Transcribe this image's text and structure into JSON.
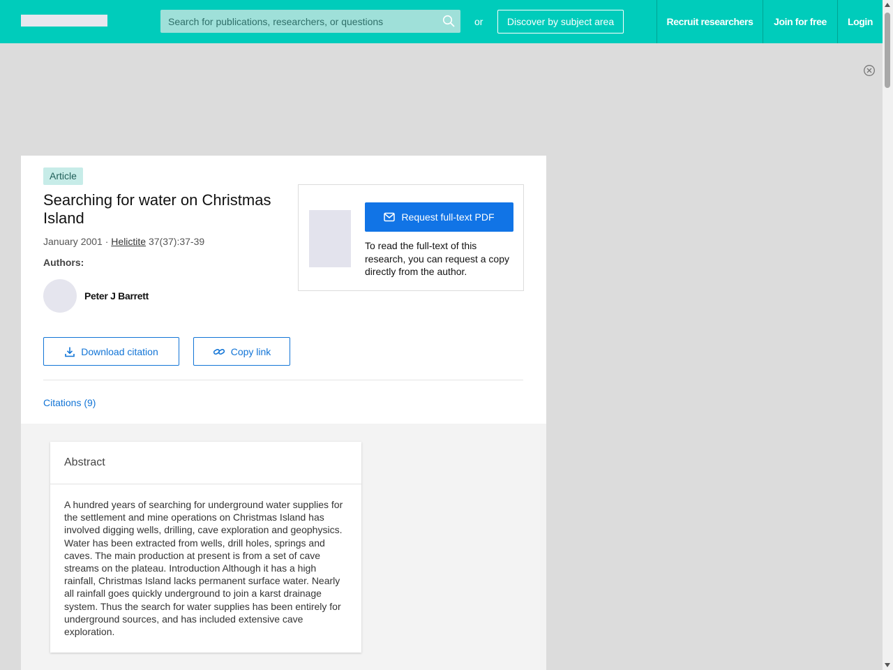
{
  "header": {
    "search_placeholder": "Search for publications, researchers, or questions",
    "or_label": "or",
    "discover_label": "Discover by subject area",
    "nav": [
      "Recruit researchers",
      "Join for free",
      "Login"
    ],
    "accent_color": "#00ccbb"
  },
  "publication": {
    "type_badge": "Article",
    "title": "Searching for water on Christmas Island",
    "date": "January 2001",
    "separator": " · ",
    "journal": "Helictite",
    "volume_pages": " 37(37):37-39",
    "authors_label": "Authors:",
    "authors": [
      "Peter J Barrett"
    ],
    "download_citation_label": "Download citation",
    "copy_link_label": "Copy link",
    "citations_tab": "Citations (9)"
  },
  "request": {
    "button_label": "Request full-text PDF",
    "description": "To read the full-text of this research, you can request a copy directly from the author."
  },
  "abstract": {
    "heading": "Abstract",
    "text": "A hundred years of searching for underground water supplies for the settlement and mine operations on Christmas Island has involved digging wells, drilling, cave exploration and geophysics. Water has been extracted from wells, drill holes, springs and caves. The main production at present is from a set of cave streams on the plateau. Introduction Although it has a high rainfall, Christmas Island lacks permanent surface water. Nearly all rainfall goes quickly underground to join a karst drainage system. Thus the search for water supplies has been entirely for underground sources, and has included extensive cave exploration."
  },
  "icons": {
    "search": "search-icon",
    "close": "close-circle-icon",
    "download": "download-icon",
    "link": "link-icon",
    "mail": "mail-icon"
  }
}
